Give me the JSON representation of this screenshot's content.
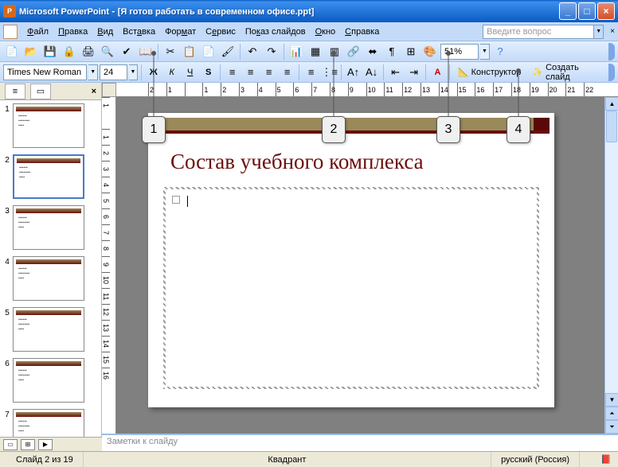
{
  "window": {
    "app": "Microsoft PowerPoint",
    "doc": "[Я готов работать в современном офисе.ppt]"
  },
  "menu": {
    "file": "Файл",
    "edit": "Правка",
    "view": "Вид",
    "insert": "Вставка",
    "format": "Формат",
    "tools": "Сервис",
    "slideshow": "Показ слайдов",
    "window": "Окно",
    "help": "Справка",
    "ask": "Введите вопрос"
  },
  "toolbar": {
    "font": "Times New Roman",
    "size": "24",
    "zoom": "51%",
    "designer": "Конструктор",
    "newslide": "Создать слайд"
  },
  "ruler_h": [
    "2",
    "1",
    "",
    "1",
    "2",
    "3",
    "4",
    "5",
    "6",
    "7",
    "8",
    "9",
    "10",
    "11",
    "12",
    "13",
    "14",
    "15",
    "16",
    "17",
    "18",
    "19",
    "20",
    "21",
    "22"
  ],
  "ruler_v": [
    "1",
    "",
    "1",
    "2",
    "3",
    "4",
    "5",
    "6",
    "7",
    "8",
    "9",
    "10",
    "11",
    "12",
    "13",
    "14",
    "15",
    "16"
  ],
  "slide": {
    "title": "Состав учебного комплекса"
  },
  "thumbs": [
    {
      "n": "1"
    },
    {
      "n": "2",
      "sel": true
    },
    {
      "n": "3"
    },
    {
      "n": "4"
    },
    {
      "n": "5"
    },
    {
      "n": "6"
    },
    {
      "n": "7"
    }
  ],
  "callouts": {
    "c1": "1",
    "c2": "2",
    "c3": "3",
    "c4": "4"
  },
  "notes": "Заметки к слайду",
  "status": {
    "pos": "Слайд 2 из 19",
    "design": "Квадрант",
    "lang": "русский (Россия)"
  },
  "winctl": {
    "min": "_",
    "max": "□",
    "close": "×"
  }
}
